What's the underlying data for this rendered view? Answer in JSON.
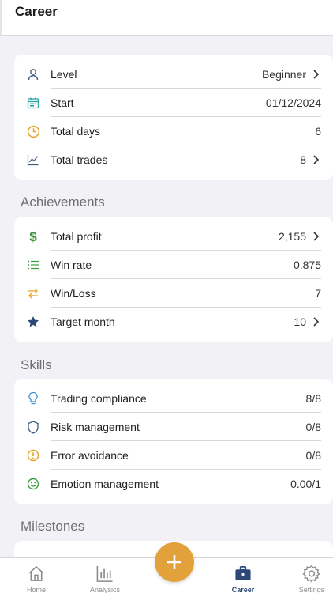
{
  "header": {
    "title": "Career"
  },
  "career": [
    {
      "label": "Level",
      "value": "Beginner",
      "icon": "user-icon",
      "chevron": true
    },
    {
      "label": "Start",
      "value": "01/12/2024",
      "icon": "calendar-icon",
      "chevron": false
    },
    {
      "label": "Total days",
      "value": "6",
      "icon": "clock-icon",
      "chevron": false
    },
    {
      "label": "Total trades",
      "value": "8",
      "icon": "chart-line-icon",
      "chevron": true
    }
  ],
  "sections": {
    "achievements": "Achievements",
    "skills": "Skills",
    "milestones": "Milestones"
  },
  "achievements": [
    {
      "label": "Total profit",
      "value": "2,155",
      "icon": "dollar-icon",
      "chevron": true
    },
    {
      "label": "Win rate",
      "value": "0.875",
      "icon": "list-icon",
      "chevron": false
    },
    {
      "label": "Win/Loss",
      "value": "7",
      "icon": "swap-icon",
      "chevron": false
    },
    {
      "label": "Target month",
      "value": "10",
      "icon": "star-icon",
      "chevron": true
    }
  ],
  "skills": [
    {
      "label": "Trading compliance",
      "value": "8/8",
      "icon": "lightbulb-icon",
      "chevron": false
    },
    {
      "label": "Risk management",
      "value": "0/8",
      "icon": "shield-icon",
      "chevron": false
    },
    {
      "label": "Error avoidance",
      "value": "0/8",
      "icon": "alert-icon",
      "chevron": false
    },
    {
      "label": "Emotion management",
      "value": "0.00/1",
      "icon": "smile-icon",
      "chevron": false
    }
  ],
  "nav": [
    {
      "label": "Home",
      "icon": "home-icon"
    },
    {
      "label": "Analysics",
      "icon": "analytics-icon"
    },
    {
      "label": "Career",
      "icon": "briefcase-icon"
    },
    {
      "label": "Settings",
      "icon": "gear-icon"
    }
  ],
  "colors": {
    "accent": "#e2a13b",
    "navActive": "#2d4877",
    "profit": "#3c9a3c",
    "calendar": "#2aa0a0",
    "clock": "#e5a21e",
    "star": "#2d4877",
    "bulb": "#3a8ed8"
  }
}
